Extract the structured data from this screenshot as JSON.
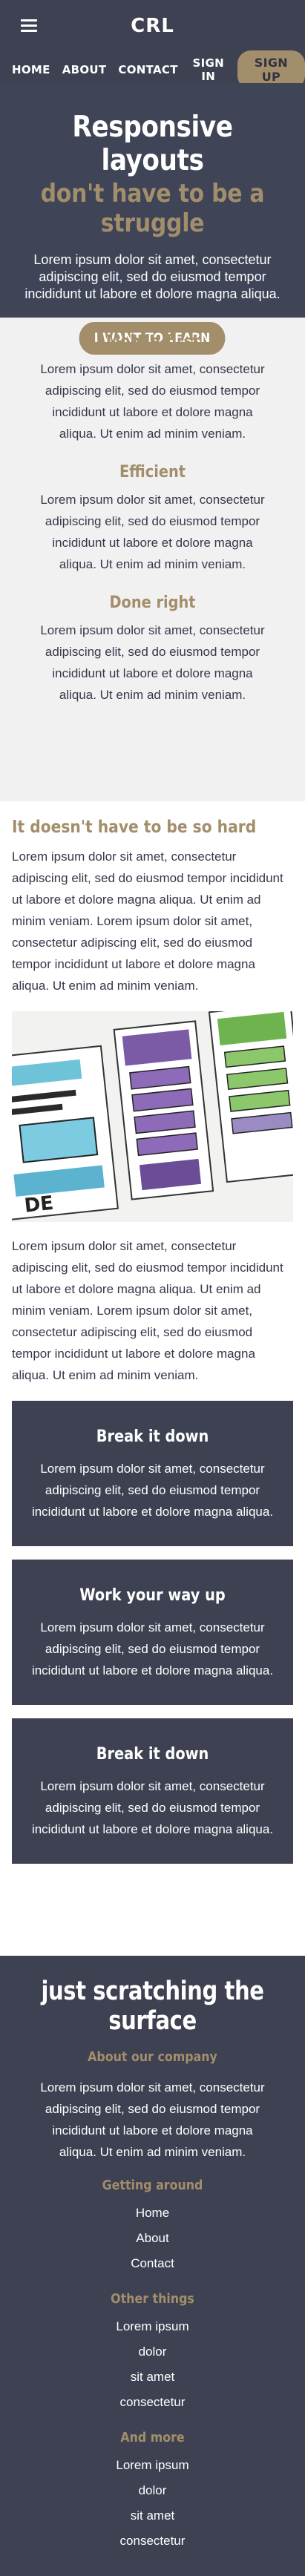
{
  "brand": {
    "logo": "CRL"
  },
  "nav": {
    "items": [
      {
        "label": "HOME"
      },
      {
        "label": "ABOUT"
      },
      {
        "label": "CONTACT"
      },
      {
        "label": "SIGN IN"
      }
    ],
    "signup": "SIGN UP"
  },
  "hero": {
    "title": "Responsive layouts",
    "subtitle": "don't have to be a struggle",
    "text": "Lorem ipsum dolor sit amet, consectetur adipiscing elit, sed do eiusmod tempor incididunt ut labore et dolore magna aliqua.",
    "cta": "I WANT TO LEARN"
  },
  "features": [
    {
      "title": "Mobile-first",
      "text": "Lorem ipsum dolor sit amet, consectetur adipiscing elit, sed do eiusmod tempor incididunt ut labore et dolore magna aliqua. Ut enim ad minim veniam."
    },
    {
      "title": "Efficient",
      "text": "Lorem ipsum dolor sit amet, consectetur adipiscing elit, sed do eiusmod tempor incididunt ut labore et dolore magna aliqua. Ut enim ad minim veniam."
    },
    {
      "title": "Done right",
      "text": "Lorem ipsum dolor sit amet, consectetur adipiscing elit, sed do eiusmod tempor incididunt ut labore et dolore magna aliqua. Ut enim ad minim veniam."
    }
  ],
  "article": {
    "heading": "It doesn't have to be so hard",
    "para1": "Lorem ipsum dolor sit amet, consectetur adipiscing elit, sed do eiusmod tempor incididunt ut labore et dolore magna aliqua. Ut enim ad minim veniam. Lorem ipsum dolor sit amet, consectetur adipiscing elit, sed do eiusmod tempor incididunt ut labore et dolore magna aliqua. Ut enim ad minim veniam.",
    "para2": "Lorem ipsum dolor sit amet, consectetur adipiscing elit, sed do eiusmod tempor incididunt ut labore et dolore magna aliqua. Ut enim ad minim veniam. Lorem ipsum dolor sit amet, consectetur adipiscing elit, sed do eiusmod tempor incididunt ut labore et dolore magna aliqua. Ut enim ad minim veniam."
  },
  "cards": [
    {
      "title": "Break it down",
      "text": "Lorem ipsum dolor sit amet, consectetur adipiscing elit, sed do eiusmod tempor incididunt ut labore et dolore magna aliqua."
    },
    {
      "title": "Work your way up",
      "text": "Lorem ipsum dolor sit amet, consectetur adipiscing elit, sed do eiusmod tempor incididunt ut labore et dolore magna aliqua."
    },
    {
      "title": "Break it down",
      "text": "Lorem ipsum dolor sit amet, consectetur adipiscing elit, sed do eiusmod tempor incididunt ut labore et dolore magna aliqua."
    }
  ],
  "footer": {
    "title": "just scratching the surface",
    "about_heading": "About our company",
    "about_text": "Lorem ipsum dolor sit amet, consectetur adipiscing elit, sed do eiusmod tempor incididunt ut labore et dolore magna aliqua. Ut enim ad minim veniam.",
    "getting_around_heading": "Getting around",
    "getting_around": [
      "Home",
      "About",
      "Contact"
    ],
    "other_heading": "Other things",
    "other": [
      "Lorem ipsum",
      "dolor",
      "sit amet",
      "consectetur"
    ],
    "more_heading": "And more",
    "more": [
      "Lorem ipsum",
      "dolor",
      "sit amet",
      "consectetur"
    ]
  },
  "colors": {
    "dark": "#3d4152",
    "accent": "#a38e6c",
    "light": "#f1f1f1"
  }
}
